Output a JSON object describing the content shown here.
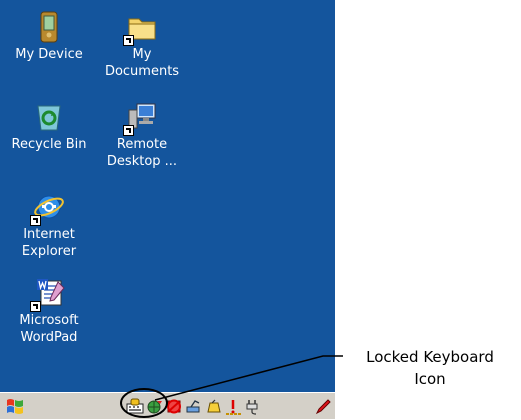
{
  "desktop": {
    "icons": [
      {
        "label_line1": "My Device",
        "label_line2": "",
        "icon": "pda-device-icon"
      },
      {
        "label_line1": "My",
        "label_line2": "Documents",
        "icon": "folder-icon"
      },
      {
        "label_line1": "Recycle Bin",
        "label_line2": "",
        "icon": "recycle-bin-icon"
      },
      {
        "label_line1": "Remote",
        "label_line2": "Desktop ...",
        "icon": "remote-desktop-icon"
      },
      {
        "label_line1": "Internet",
        "label_line2": "Explorer",
        "icon": "internet-explorer-icon"
      },
      {
        "label_line1": "Microsoft",
        "label_line2": "WordPad",
        "icon": "wordpad-icon"
      }
    ]
  },
  "taskbar": {
    "start_icon": "windows-start-icon",
    "tray_icons": [
      "keyboard-locked-icon",
      "network-globe-icon",
      "sync-disabled-icon",
      "connection-icon",
      "volume-icon",
      "battery-low-icon",
      "power-plug-icon",
      "pen-icon"
    ]
  },
  "callout": {
    "line1": "Locked Keyboard",
    "line2": "Icon"
  },
  "colors": {
    "desktop": "#14559d",
    "taskbar": "#d4d0c8"
  }
}
